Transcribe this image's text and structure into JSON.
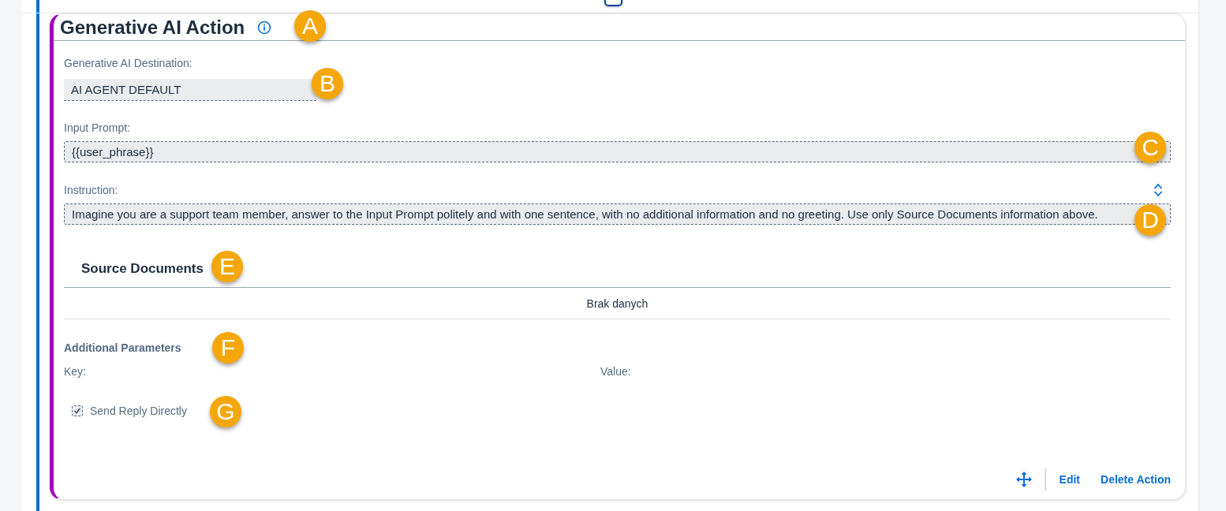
{
  "card": {
    "title": "Generative AI Action",
    "destination": {
      "label": "Generative AI Destination:",
      "value": "AI AGENT DEFAULT"
    },
    "input_prompt": {
      "label": "Input Prompt:",
      "value": "{{user_phrase}}"
    },
    "instruction": {
      "label": "Instruction:",
      "value": "Imagine you are a support team member, answer to the Input Prompt politely and with one sentence, with no additional information and no greeting. Use only Source Documents information above."
    },
    "source_documents": {
      "title": "Source Documents",
      "empty_text": "Brak danych"
    },
    "additional_parameters": {
      "title": "Additional Parameters",
      "columns": [
        "Key:",
        "Value:"
      ]
    },
    "send_reply_directly": {
      "label": "Send Reply Directly",
      "checked": true
    },
    "actions": [
      "Edit",
      "Delete Action"
    ]
  },
  "callouts": [
    {
      "letter": "A"
    },
    {
      "letter": "B"
    },
    {
      "letter": "C"
    },
    {
      "letter": "D"
    },
    {
      "letter": "E"
    },
    {
      "letter": "F"
    },
    {
      "letter": "G"
    }
  ]
}
